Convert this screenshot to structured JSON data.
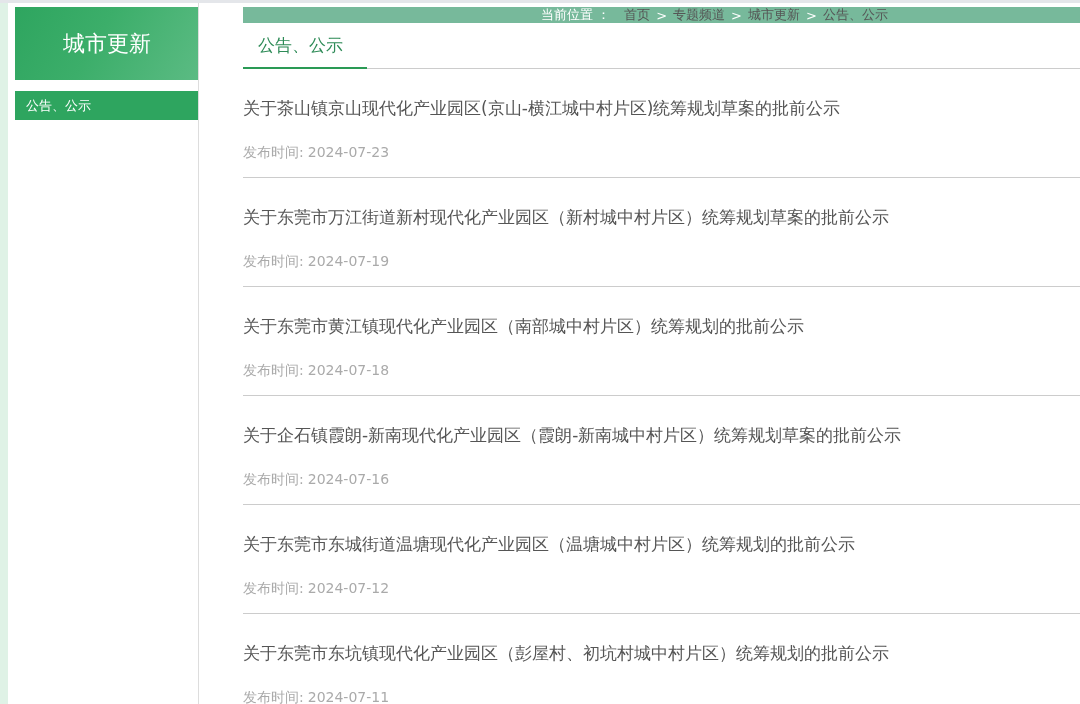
{
  "sidebar": {
    "title": "城市更新",
    "items": [
      {
        "label": "公告、公示",
        "selected": true
      }
    ]
  },
  "breadcrumb": {
    "label": "当前位置 ：",
    "items": [
      "首页",
      "专题频道",
      "城市更新",
      "公告、公示"
    ],
    "separator": ">"
  },
  "tabs": [
    {
      "label": "公告、公示",
      "selected": true
    }
  ],
  "articles": [
    {
      "title": "关于茶山镇京山现代化产业园区(京山-横江城中村片区)统筹规划草案的批前公示",
      "date_label": "发布时间:",
      "date": "2024-07-23"
    },
    {
      "title": "关于东莞市万江街道新村现代化产业园区（新村城中村片区）统筹规划草案的批前公示",
      "date_label": "发布时间:",
      "date": "2024-07-19"
    },
    {
      "title": "关于东莞市黄江镇现代化产业园区（南部城中村片区）统筹规划的批前公示",
      "date_label": "发布时间:",
      "date": "2024-07-18"
    },
    {
      "title": "关于企石镇霞朗-新南现代化产业园区（霞朗-新南城中村片区）统筹规划草案的批前公示",
      "date_label": "发布时间:",
      "date": "2024-07-16"
    },
    {
      "title": "关于东莞市东城街道温塘现代化产业园区（温塘城中村片区）统筹规划的批前公示",
      "date_label": "发布时间:",
      "date": "2024-07-12"
    },
    {
      "title": "关于东莞市东坑镇现代化产业园区（彭屋村、初坑村城中村片区）统筹规划的批前公示",
      "date_label": "发布时间:",
      "date": "2024-07-11"
    }
  ]
}
